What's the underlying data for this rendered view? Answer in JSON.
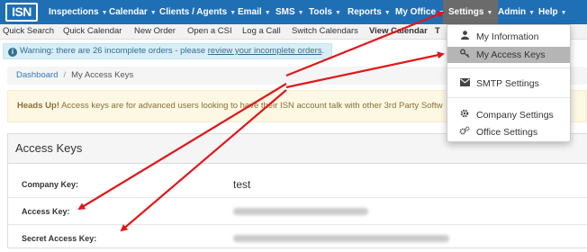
{
  "topnav": {
    "logo": "ISN",
    "items": [
      {
        "label": "Inspections"
      },
      {
        "label": "Calendar"
      },
      {
        "label": "Clients / Agents"
      },
      {
        "label": "Email"
      },
      {
        "label": "SMS"
      },
      {
        "label": "Tools"
      },
      {
        "label": "Reports"
      },
      {
        "label": "My Office"
      },
      {
        "label": "Settings"
      },
      {
        "label": "Admin"
      },
      {
        "label": "Help"
      }
    ]
  },
  "subnav": {
    "items": [
      {
        "label": "Quick Search"
      },
      {
        "label": "Quick Calendar"
      },
      {
        "label": "New Order"
      },
      {
        "label": "Open a CSI"
      },
      {
        "label": "Log a Call"
      },
      {
        "label": "Switch Calendars"
      },
      {
        "label": "View Calendar"
      },
      {
        "label": "T"
      }
    ]
  },
  "warning": {
    "text": "Warning: there are 26 incomplete orders - please ",
    "link": "review your incomplete orders"
  },
  "breadcrumb": {
    "home": "Dashboard",
    "separator": "/",
    "current": "My Access Keys"
  },
  "headsup": {
    "strong": "Heads Up!",
    "text": " Access keys are for advanced users looking to have their ISN account talk with other 3rd Party Softw"
  },
  "panel": {
    "title": "Access Keys",
    "rows": [
      {
        "label": "Company Key:",
        "value": "test"
      },
      {
        "label": "Access Key:",
        "value": ""
      },
      {
        "label": "Secret Access Key:",
        "value": ""
      }
    ]
  },
  "dropdown": {
    "items": [
      {
        "label": "My Information",
        "icon": "user-icon"
      },
      {
        "label": "My Access Keys",
        "icon": "key-icon"
      },
      {
        "label": "SMTP Settings",
        "icon": "envelope-icon"
      },
      {
        "label": "Company Settings",
        "icon": "gear-icon"
      },
      {
        "label": "Office Settings",
        "icon": "gears-icon"
      }
    ]
  },
  "colors": {
    "navbar": "#1f6fb5",
    "active_nav": "#6b6b6b",
    "arrow": "#e0171b",
    "highlight": "#b5b5b5"
  }
}
